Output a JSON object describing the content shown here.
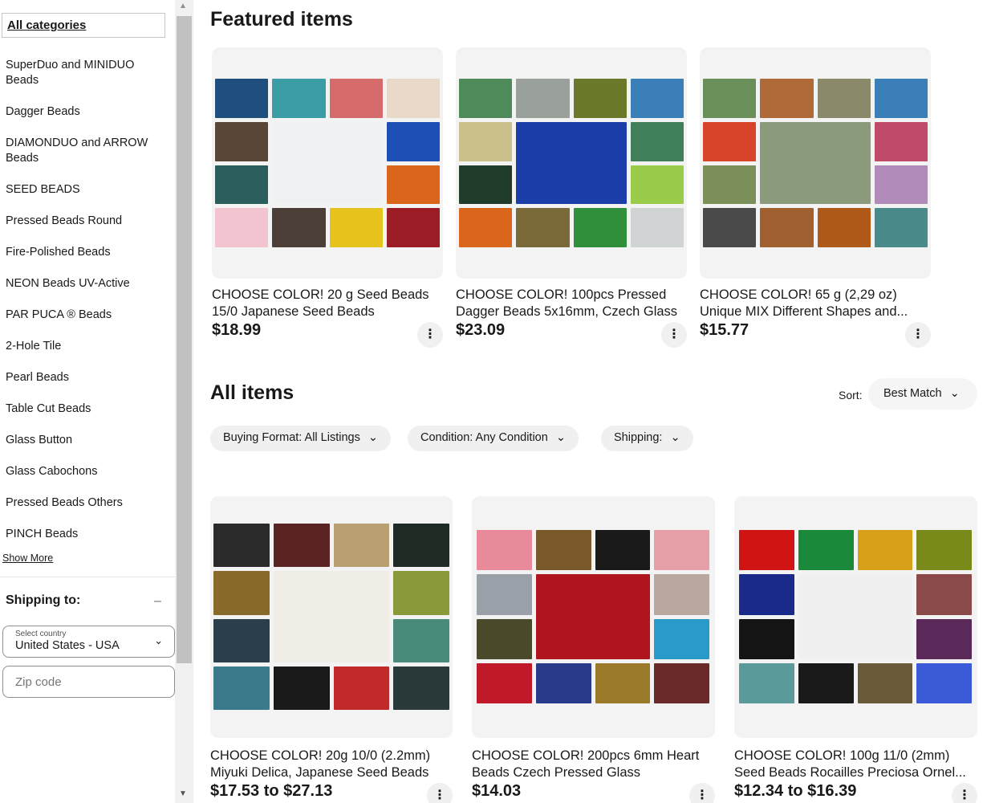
{
  "sidebar": {
    "all_categories": "All categories",
    "categories": [
      "SuperDuo and MINIDUO Beads",
      "Dagger Beads",
      "DIAMONDUO and ARROW Beads",
      "SEED BEADS",
      "Pressed Beads Round",
      "Fire-Polished Beads",
      "NEON Beads UV-Active",
      "PAR PUCA ® Beads",
      "2-Hole Tile",
      "Pearl Beads",
      "Table Cut Beads",
      "Glass Button",
      "Glass Cabochons",
      "Pressed Beads Others",
      "PINCH Beads"
    ],
    "show_more": "Show More",
    "shipping_title": "Shipping to:",
    "collapse_symbol": "–",
    "country_label": "Select country",
    "country_value": "United States - USA",
    "zip_placeholder": "Zip code"
  },
  "featured": {
    "heading": "Featured items",
    "items": [
      {
        "title_line1": "CHOOSE COLOR! 20 g Seed Beads",
        "title_line2": "15/0 Japanese Seed Beads",
        "price": "$18.99"
      },
      {
        "title_line1": "CHOOSE COLOR! 100pcs Pressed",
        "title_line2": "Dagger Beads 5x16mm, Czech Glass",
        "price": "$23.09"
      },
      {
        "title_line1": "CHOOSE COLOR! 65 g (2,29 oz)",
        "title_line2": "Unique MIX Different Shapes and...",
        "price": "$15.77"
      }
    ]
  },
  "all_items": {
    "heading": "All items",
    "sort_label": "Sort:",
    "sort_value": "Best Match",
    "filters": [
      "Buying Format: All Listings",
      "Condition: Any Condition",
      "Shipping:"
    ],
    "items": [
      {
        "title_line1": "CHOOSE COLOR! 20g 10/0 (2.2mm)",
        "title_line2": "Miyuki Delica, Japanese Seed Beads",
        "price": "$17.53 to $27.13"
      },
      {
        "title_line1": "CHOOSE COLOR! 200pcs 6mm Heart",
        "title_line2": "Beads Czech Pressed Glass",
        "price": "$14.03"
      },
      {
        "title_line1": "CHOOSE COLOR! 100g 11/0 (2mm)",
        "title_line2": "Seed Beads Rocailles Preciosa Ornel...",
        "price": "$12.34 to $16.39"
      }
    ]
  },
  "icons": {
    "more": "⋮",
    "chevron": "⌄",
    "scroll_up": "▲",
    "scroll_down": "▼"
  },
  "swatches": {
    "featured_0": [
      "#1f4f7d",
      "#3b9ea6",
      "#d66b6b",
      "#e8d9c8",
      "#5a4636",
      "#eef2f2",
      "#eef2f2",
      "#1e4fb5",
      "#2a5d5c",
      "#eef2f2",
      "#eef2f2",
      "#d9661b",
      "#f2c4cf",
      "#4b3f38",
      "#e6c21c",
      "#9b1c25"
    ],
    "featured_1": [
      "#4e8a5a",
      "#9aa09a",
      "#6b7a2a",
      "#3a7fb8",
      "#c9c08a",
      "#1b3ea8",
      "#1b3ea8",
      "#3f7f5a",
      "#1f3d2a",
      "#1b3ea8",
      "#1b3ea8",
      "#9acb4a",
      "#d9661b",
      "#7a6a3a",
      "#2f8f3a",
      "#cfd3d3"
    ],
    "featured_2": [
      "#6a8f5a",
      "#b06a3a",
      "#8a8a6a",
      "#3a7fb8",
      "#d6452a",
      "#8a9a7a",
      "#8a9a7a",
      "#c04a6a",
      "#7a8f5a",
      "#8a9a7a",
      "#8a9a7a",
      "#b08ab8",
      "#4a4a4a",
      "#a06030",
      "#b05a1a",
      "#4a8a8a"
    ],
    "all_0": [
      "#2a2a2a",
      "#5a2424",
      "#b8a070",
      "#1f2a24",
      "#8a6a2a",
      "#f0ece6",
      "#f0ece6",
      "#8a9a3a",
      "#2a3f4a",
      "#f0ece6",
      "#f0ece6",
      "#4a8a7a",
      "#3a7a8a",
      "#1a1a1a",
      "#c02a2a",
      "#2a3a3a"
    ],
    "all_1": [
      "#e88a9a",
      "#7a5a2a",
      "#1a1a1a",
      "#e8a0a8",
      "#9aa0a8",
      "#b0141e",
      "#b0141e",
      "#b8a8a0",
      "#4a4a2a",
      "#b0141e",
      "#b0141e",
      "#2a9ac8",
      "#c01a2a",
      "#2a3a8a",
      "#9a7a2a",
      "#6a2a2a"
    ],
    "all_2": [
      "#d01414",
      "#1a8a3a",
      "#d8a018",
      "#7a8a1a",
      "#1a2a8a",
      "#f0f0f0",
      "#f0f0f0",
      "#8a4a4a",
      "#141414",
      "#f0f0f0",
      "#f0f0f0",
      "#5a2a5a",
      "#5a9a9a",
      "#1a1a1a",
      "#6a5a3a",
      "#3a5ad8"
    ]
  }
}
